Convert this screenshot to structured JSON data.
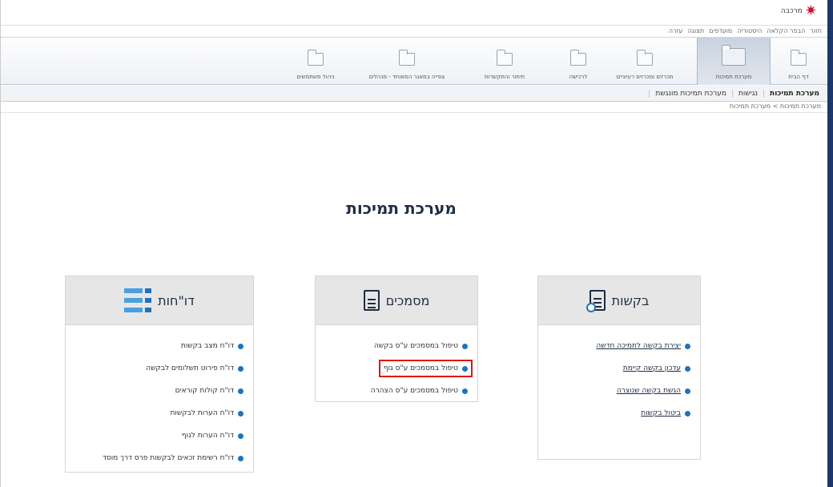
{
  "header": {
    "logo_text": "מרכבה",
    "links": [
      "חזור",
      "הבפר הקלאה",
      "היסטוריה",
      "מועדפים",
      "תצוגה",
      "עזרה"
    ]
  },
  "tabs": [
    {
      "label": "דף הבית"
    },
    {
      "label": "מערכת תמיכות"
    },
    {
      "label": "מכרזים ומכרזים רעיוניים"
    },
    {
      "label": "לרכישה"
    },
    {
      "label": "תיחור והתקשרות"
    },
    {
      "label": "צפייה במאגר המאוחד - מנהלים"
    },
    {
      "label": "ניהול משתמשים"
    }
  ],
  "subnav": {
    "items": [
      "מערכת תמיכות",
      "נגישות",
      "מערכת תמיכות מונגשת"
    ]
  },
  "breadcrumb": {
    "first": "מערכת תמיכות",
    "sep": ">",
    "second": "מערכת תמיכות"
  },
  "page_title": "מערכת תמיכות",
  "panels": {
    "requests": {
      "title": "בקשות",
      "items": [
        "יצירת בקשה לתמיכה חדשה",
        "עדכון בקשה קיימת",
        "הגשת בקשה שנוצרה",
        "ביטול בקשות"
      ]
    },
    "documents": {
      "title": "מסמכים",
      "items": [
        "טיפול במסמכים ע\"ס בקשה",
        "טיפול במסמכים ע\"ס גוף",
        "טיפול במסמכים ע\"ס הצהרה"
      ]
    },
    "reports": {
      "title": "דו\"חות",
      "items": [
        "דו\"ח מצב בקשות",
        "דו\"ח פירוט תשלומים לבקשה",
        "דו\"ח קולות קוראים",
        "דו\"ח הערות לבקשות",
        "דו\"ח הערות לגוף",
        "דו\"ח רשימת זכאים לבקשות פרס דרך מוסד"
      ]
    }
  },
  "colors": {
    "accent": "#1e73be",
    "title": "#1f2d44",
    "highlight": "#e01515",
    "right_bar": "#1d3766"
  }
}
